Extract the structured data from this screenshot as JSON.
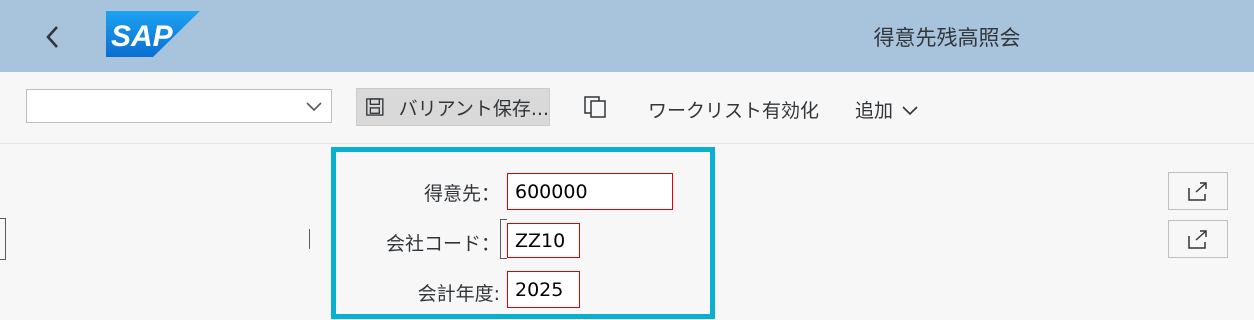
{
  "shell": {
    "title": "得意先残高照会",
    "logo_text": "SAP",
    "brand_color": "#0a6ed1"
  },
  "toolbar": {
    "variant_value": "",
    "save_variant_label": "バリアント保存...",
    "worklist_label": "ワークリスト有効化",
    "add_label": "追加"
  },
  "form": {
    "customer_label": "得意先：",
    "customer_value": "600000",
    "company_code_label": "会社コード：",
    "company_code_value": "ZZ10",
    "fiscal_year_label": "会計年度:",
    "fiscal_year_value": "2025"
  },
  "colors": {
    "shell_bg": "#a7c4dc",
    "highlight": "#0ab0cf",
    "error_border": "#e00000"
  }
}
